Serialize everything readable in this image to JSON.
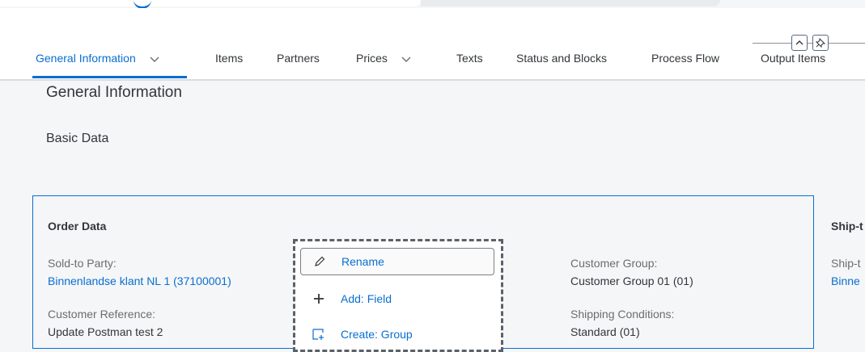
{
  "tabs": [
    {
      "label": "General Information",
      "has_dropdown": true,
      "active": true
    },
    {
      "label": "Items"
    },
    {
      "label": "Partners"
    },
    {
      "label": "Prices",
      "has_dropdown": true
    },
    {
      "label": "Texts"
    },
    {
      "label": "Status and Blocks"
    },
    {
      "label": "Process Flow"
    },
    {
      "label": "Output Items"
    }
  ],
  "header_buttons": {
    "collapse_icon": "chevron-up-icon",
    "pin_icon": "pin-icon"
  },
  "section": {
    "title": "General Information",
    "subsection": "Basic Data"
  },
  "card": {
    "title": "Order Data",
    "fields": {
      "sold_to_label": "Sold-to Party:",
      "sold_to_value": "Binnenlandse klant NL 1 (37100001)",
      "customer_ref_label": "Customer Reference:",
      "customer_ref_value": "Update Postman test 2",
      "customer_group_label": "Customer Group:",
      "customer_group_value": "Customer Group 01 (01)",
      "shipping_cond_label": "Shipping Conditions:",
      "shipping_cond_value": "Standard (01)"
    }
  },
  "right_card": {
    "title": "Ship-t",
    "field_label": "Ship-t",
    "field_value": "Binne"
  },
  "context_menu": {
    "items": [
      {
        "label": "Rename",
        "icon": "pencil-icon"
      },
      {
        "label": "Add: Field",
        "icon": "plus-icon"
      },
      {
        "label": "Create: Group",
        "icon": "create-group-icon"
      }
    ]
  },
  "colors": {
    "accent": "#0a6ed1",
    "text": "#32363a",
    "label": "#6a6d70"
  }
}
